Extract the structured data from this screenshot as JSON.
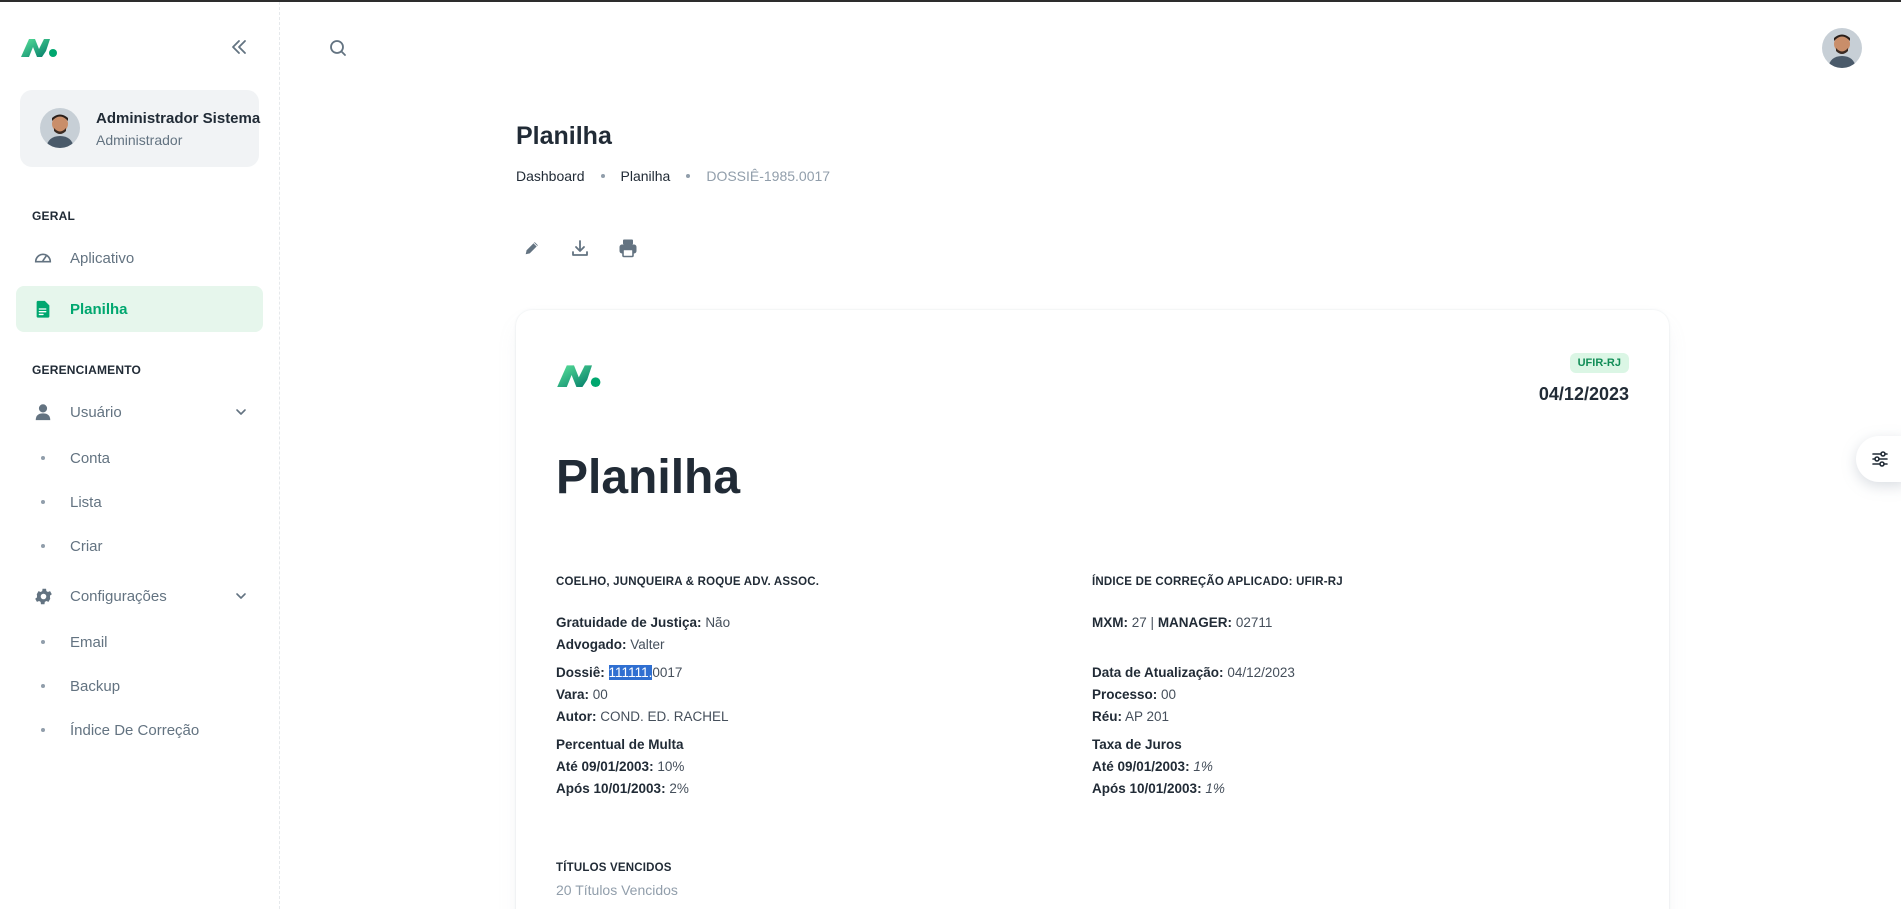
{
  "sidebar": {
    "user": {
      "name": "Administrador Sistema",
      "role": "Administrador"
    },
    "sections": [
      {
        "title": "GERAL"
      },
      {
        "title": "GERENCIAMENTO"
      }
    ],
    "items": [
      {
        "label": "Aplicativo",
        "icon": "dashboard-icon"
      },
      {
        "label": "Planilha",
        "icon": "file-icon",
        "active": true
      },
      {
        "label": "Usuário",
        "icon": "user-icon"
      },
      {
        "label": "Conta"
      },
      {
        "label": "Lista"
      },
      {
        "label": "Criar"
      },
      {
        "label": "Configurações",
        "icon": "gear-icon"
      },
      {
        "label": "Email"
      },
      {
        "label": "Backup"
      },
      {
        "label": "Índice De Correção"
      }
    ]
  },
  "header": {
    "search_icon": "search-icon"
  },
  "page": {
    "title": "Planilha",
    "breadcrumb": [
      "Dashboard",
      "Planilha",
      "DOSSIÊ-1985.0017"
    ]
  },
  "invoice": {
    "badge": "UFIR-RJ",
    "date": "04/12/2023",
    "title": "Planilha",
    "left": {
      "heading": "COELHO, JUNQUEIRA & ROQUE ADV. ASSOC.",
      "gratuidade_label": "Gratuidade de Justiça:",
      "gratuidade_value": "Não",
      "advogado_label": "Advogado:",
      "advogado_value": "Valter",
      "dossie_label": "Dossiê:",
      "dossie_highlight": "111111.",
      "dossie_rest": "0017",
      "vara_label": "Vara:",
      "vara_value": "00",
      "autor_label": "Autor:",
      "autor_value": "COND. ED. RACHEL",
      "multa_title": "Percentual de Multa",
      "multa_ate_label": "Até 09/01/2003:",
      "multa_ate_value": "10%",
      "multa_apos_label": "Após 10/01/2003:",
      "multa_apos_value": "2%"
    },
    "right": {
      "heading": "ÍNDICE DE CORREÇÃO APLICADO: UFIR-RJ",
      "mxm_label": "MXM:",
      "mxm_value": "27 |",
      "manager_label": "MANAGER:",
      "manager_value": "02711",
      "atualizacao_label": "Data de Atualização:",
      "atualizacao_value": "04/12/2023",
      "processo_label": "Processo:",
      "processo_value": "00",
      "reu_label": "Réu:",
      "reu_value": "AP 201",
      "juros_title": "Taxa de Juros",
      "juros_ate_label": "Até 09/01/2003:",
      "juros_ate_value": "1%",
      "juros_apos_label": "Após 10/01/2003:",
      "juros_apos_value": "1%"
    },
    "titulos_heading": "TÍTULOS VENCIDOS",
    "titulos_sub": "20 Títulos Vencidos"
  },
  "colors": {
    "accent": "#00a76f",
    "active_bg": "#e6f6ec",
    "text": "#212b36",
    "muted": "#637381"
  }
}
